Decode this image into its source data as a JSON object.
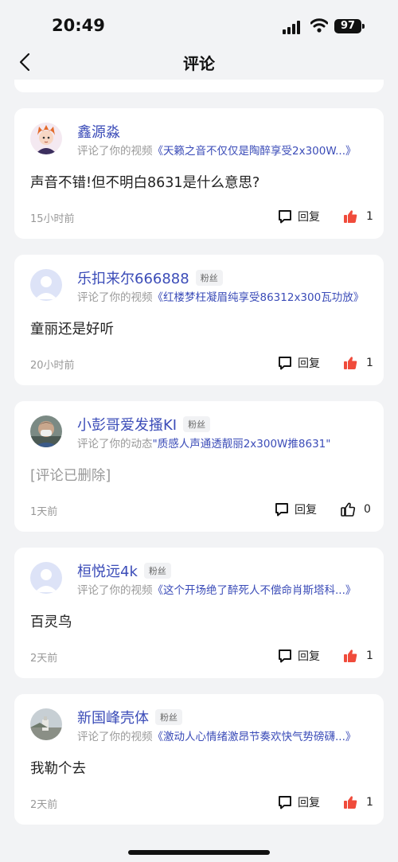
{
  "status_bar": {
    "time": "20:49",
    "battery": "97"
  },
  "nav": {
    "title": "评论"
  },
  "comments": [
    {
      "user": "鑫源淼",
      "fan_badge": "",
      "avatar": "cartoon-avatar",
      "action": "评论了你的视频",
      "work": "《天籁之音不仅仅是陶醉享受2x300W...》",
      "text": "声音不错!但不明白8631是什么意思?",
      "deleted": false,
      "time": "15小时前",
      "reply_label": "回复",
      "likes": "1",
      "liked": true
    },
    {
      "user": "乐扣来尔666888",
      "fan_badge": "粉丝",
      "avatar": "default-avatar",
      "action": "评论了你的视频",
      "work": "《红楼梦枉凝眉纯享受86312x300瓦功放》",
      "text": "童丽还是好听",
      "deleted": false,
      "time": "20小时前",
      "reply_label": "回复",
      "likes": "1",
      "liked": true
    },
    {
      "user": "小彭哥爱发搔KI",
      "fan_badge": "粉丝",
      "avatar": "photo-avatar",
      "action": "评论了你的动态",
      "work": "\"质感人声通透靓丽2x300W推8631\"",
      "text": "[评论已删除]",
      "deleted": true,
      "time": "1天前",
      "reply_label": "回复",
      "likes": "0",
      "liked": false
    },
    {
      "user": "桓悦远4k",
      "fan_badge": "粉丝",
      "avatar": "default-avatar",
      "action": "评论了你的视频",
      "work": "《这个开场绝了醉死人不偿命肖斯塔科...》",
      "text": "百灵鸟",
      "deleted": false,
      "time": "2天前",
      "reply_label": "回复",
      "likes": "1",
      "liked": true
    },
    {
      "user": "新国峰壳体",
      "fan_badge": "粉丝",
      "avatar": "landscape-avatar",
      "action": "评论了你的视频",
      "work": "《激动人心情绪激昂节奏欢快气势磅礴...》",
      "text": "我勒个去",
      "deleted": false,
      "time": "2天前",
      "reply_label": "回复",
      "likes": "1",
      "liked": true
    }
  ],
  "colors": {
    "accent": "#3b4cb8",
    "liked": "#f04b3b",
    "background": "#f2f3f5"
  }
}
